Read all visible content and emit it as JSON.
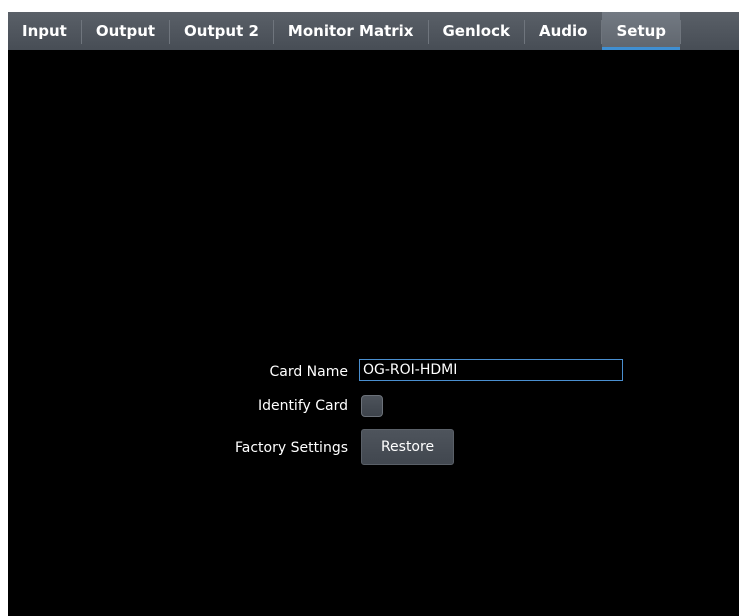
{
  "tabs": [
    {
      "label": "Input"
    },
    {
      "label": "Output"
    },
    {
      "label": "Output 2"
    },
    {
      "label": "Monitor Matrix"
    },
    {
      "label": "Genlock"
    },
    {
      "label": "Audio"
    },
    {
      "label": "Setup",
      "active": true
    }
  ],
  "setup": {
    "card_name_label": "Card Name",
    "card_name_value": "OG-ROI-HDMI",
    "identify_card_label": "Identify Card",
    "identify_card_checked": false,
    "factory_settings_label": "Factory Settings",
    "restore_button_label": "Restore"
  },
  "colors": {
    "tab_bar": "#4f555d",
    "active_tab_underline": "#3f8fd2",
    "background": "#000000",
    "input_border": "#4a8fd0"
  }
}
